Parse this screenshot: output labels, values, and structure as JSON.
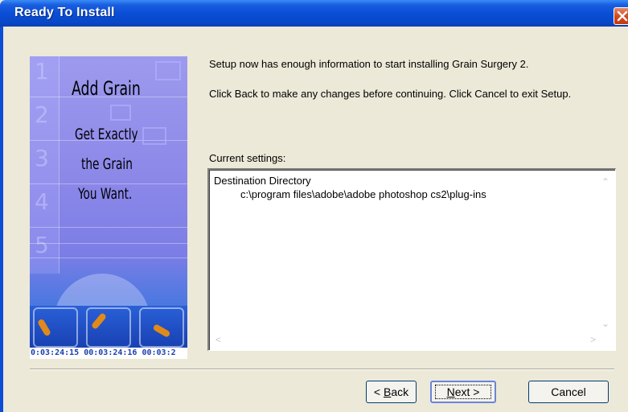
{
  "window": {
    "title": "Ready To Install"
  },
  "banner": {
    "numbers": [
      "1",
      "2",
      "3",
      "4",
      "5"
    ],
    "headline": "Add Grain",
    "tagline_lines": [
      "Get Exactly",
      "the Grain",
      "You Want."
    ],
    "timecode": "0:03:24:15 00:03:24:16 00:03:2"
  },
  "content": {
    "intro_line1": "Setup now has enough information to start installing Grain Surgery 2.",
    "intro_line2": "Click Back to make any changes before continuing. Click Cancel to exit Setup.",
    "settings_label": "Current settings:",
    "settings": {
      "heading": "Destination Directory",
      "value": "c:\\program files\\adobe\\adobe photoshop cs2\\plug-ins"
    }
  },
  "buttons": {
    "back": {
      "prefix": "< ",
      "accel": "B",
      "rest": "ack"
    },
    "next": {
      "accel": "N",
      "rest": "ext >"
    },
    "cancel": "Cancel"
  }
}
